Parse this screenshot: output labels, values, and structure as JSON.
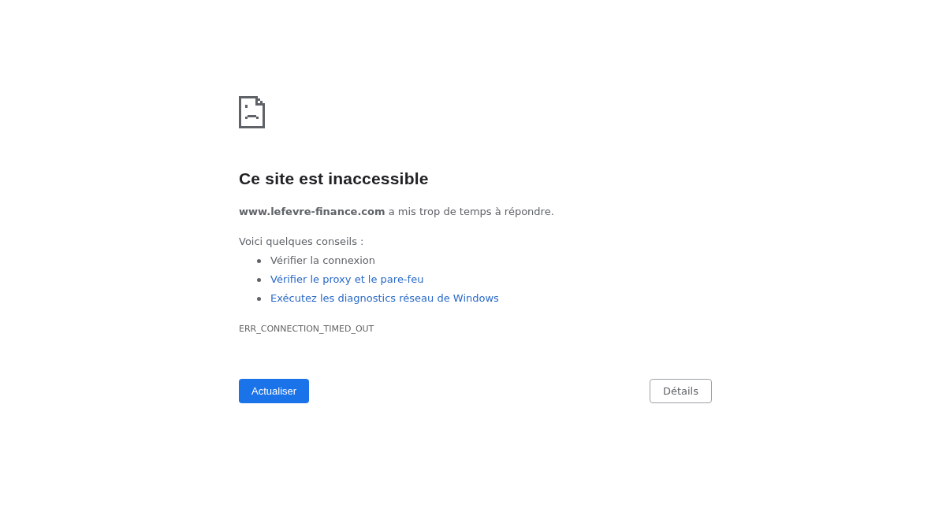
{
  "heading": "Ce site est inaccessible",
  "summary": "**www.lefevre-finance.com** a mis trop de temps à répondre.",
  "suggestions": {
    "title": "Voici quelques conseils :",
    "items": [
      {
        "kind": "text",
        "label": "Vérifier la connexion"
      },
      {
        "kind": "link",
        "label": "Vérifier le proxy et le pare-feu"
      },
      {
        "kind": "link",
        "label": "Exécutez les diagnostics réseau de Windows"
      }
    ]
  },
  "error_code": "ERR_CONNECTION_TIMED_OUT",
  "buttons": [
    {
      "kind": "primary",
      "label": "Actualiser"
    },
    {
      "kind": "secondary",
      "label": "Détails"
    }
  ]
}
